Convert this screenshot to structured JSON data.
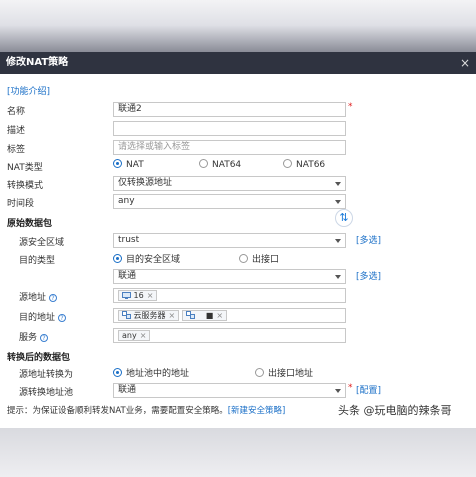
{
  "dialog": {
    "title": "修改NAT策略",
    "close_symbol": "×",
    "intro_link": "[功能介绍]"
  },
  "form": {
    "name": {
      "label": "名称",
      "value": "联通2",
      "required": "*"
    },
    "description": {
      "label": "描述",
      "value": ""
    },
    "tag": {
      "label": "标签",
      "placeholder": "请选择或输入标签"
    },
    "nat_type": {
      "label": "NAT类型",
      "options": [
        "NAT",
        "NAT64",
        "NAT66"
      ],
      "selected": "NAT"
    },
    "convert_mode": {
      "label": "转换模式",
      "value": "仅转换源地址"
    },
    "time_range": {
      "label": "时间段",
      "value": "any"
    },
    "original_packet": {
      "heading": "原始数据包",
      "source_zone": {
        "label": "源安全区域",
        "value": "trust",
        "link": "[多选]"
      },
      "dest_type": {
        "label": "目的类型",
        "options": [
          "目的安全区域",
          "出接口"
        ],
        "selected": "目的安全区域"
      },
      "dest_zone": {
        "value": "联通",
        "link": "[多选]"
      },
      "source_address": {
        "label": "源地址",
        "tags": [
          {
            "text": "16",
            "close": "×"
          }
        ]
      },
      "dest_address": {
        "label": "目的地址",
        "tags": [
          {
            "text": "云服务器",
            "close": "×"
          },
          {
            "text": "■",
            "close": "×"
          }
        ]
      },
      "service": {
        "label": "服务",
        "tags": [
          {
            "text": "any",
            "close": "×"
          }
        ]
      }
    },
    "converted_packet": {
      "heading": "转换后的数据包",
      "source_convert_to": {
        "label": "源地址转换为",
        "options": [
          "地址池中的地址",
          "出接口地址"
        ],
        "selected": "地址池中的地址"
      },
      "source_pool": {
        "label": "源转换地址池",
        "value": "联通",
        "required": "*",
        "link": "[配置]"
      }
    },
    "help_symbol": "?"
  },
  "tip": {
    "text": "提示：为保证设备顺利转发NAT业务，需要配置安全策略。",
    "link": "[新建安全策略]"
  },
  "swap_symbol": "⇅",
  "watermark": "头条 @玩电脑的辣条哥"
}
